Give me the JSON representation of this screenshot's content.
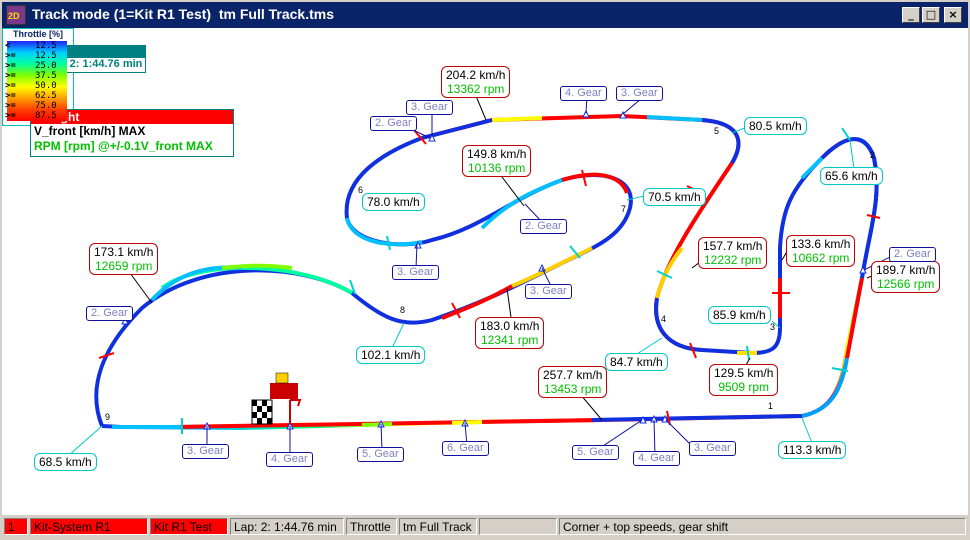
{
  "window": {
    "title": "Track mode (1=Kit R1 Test)  tm Full Track.tms",
    "icon_text": "2D"
  },
  "lap_box": {
    "header": "Lap",
    "value": "Lap 2: 1:44.76 min"
  },
  "legend_box": {
    "header": "Straight",
    "line1": "V_front [km/h] MAX",
    "line2": "RPM [rpm] @+/-0.1V_front MAX"
  },
  "throttle_legend": {
    "title": "Throttle  [%]",
    "rows": [
      {
        "op": "<",
        "value": "12.5"
      },
      {
        "op": ">=",
        "value": "12.5"
      },
      {
        "op": ">=",
        "value": "25.0"
      },
      {
        "op": ">=",
        "value": "37.5"
      },
      {
        "op": ">=",
        "value": "50.0"
      },
      {
        "op": ">=",
        "value": "62.5"
      },
      {
        "op": ">=",
        "value": "75.0"
      },
      {
        "op": ">=",
        "value": "87.5"
      }
    ]
  },
  "speed_labels": [
    "80.5 km/h",
    "65.6 km/h",
    "78.0 km/h",
    "70.5 km/h",
    "85.9 km/h",
    "84.7 km/h",
    "102.1 km/h",
    "68.5 km/h",
    "113.3 km/h"
  ],
  "double_labels": [
    {
      "speed": "204.2 km/h",
      "rpm": "13362 rpm"
    },
    {
      "speed": "149.8 km/h",
      "rpm": "10136 rpm"
    },
    {
      "speed": "173.1 km/h",
      "rpm": "12659 rpm"
    },
    {
      "speed": "157.7 km/h",
      "rpm": "12232 rpm"
    },
    {
      "speed": "133.6 km/h",
      "rpm": "10662 rpm"
    },
    {
      "speed": "189.7 km/h",
      "rpm": "12566 rpm"
    },
    {
      "speed": "183.0 km/h",
      "rpm": "12341 rpm"
    },
    {
      "speed": "257.7 km/h",
      "rpm": "13453 rpm"
    },
    {
      "speed": "129.5 km/h",
      "rpm": "9509 rpm"
    }
  ],
  "gear_labels": [
    "4. Gear",
    "3. Gear",
    "3. Gear",
    "2. Gear",
    "2. Gear",
    "3. Gear",
    "3. Gear",
    "2. Gear",
    "2. Gear",
    "3. Gear",
    "4. Gear",
    "5. Gear",
    "6. Gear",
    "5. Gear",
    "4. Gear",
    "3. Gear"
  ],
  "sector_numbers": [
    "1",
    "2",
    "3",
    "4",
    "5",
    "6",
    "7",
    "8",
    "9"
  ],
  "statusbar": {
    "f1": "1",
    "f2": "Kit-System R1",
    "f3": "Kit R1 Test",
    "f4": "Lap: 2: 1:44.76 min",
    "f5": "Throttle",
    "f6": "tm Full Track",
    "f7": "",
    "f8": "Corner + top speeds, gear shift"
  },
  "colors": {
    "title_bar": "#0a246a",
    "track_full": "#ff0000",
    "track_low": "#1030e0",
    "speed_border": "#00c8c8",
    "double_border": "#c00000",
    "rpm_text": "#00c000"
  }
}
